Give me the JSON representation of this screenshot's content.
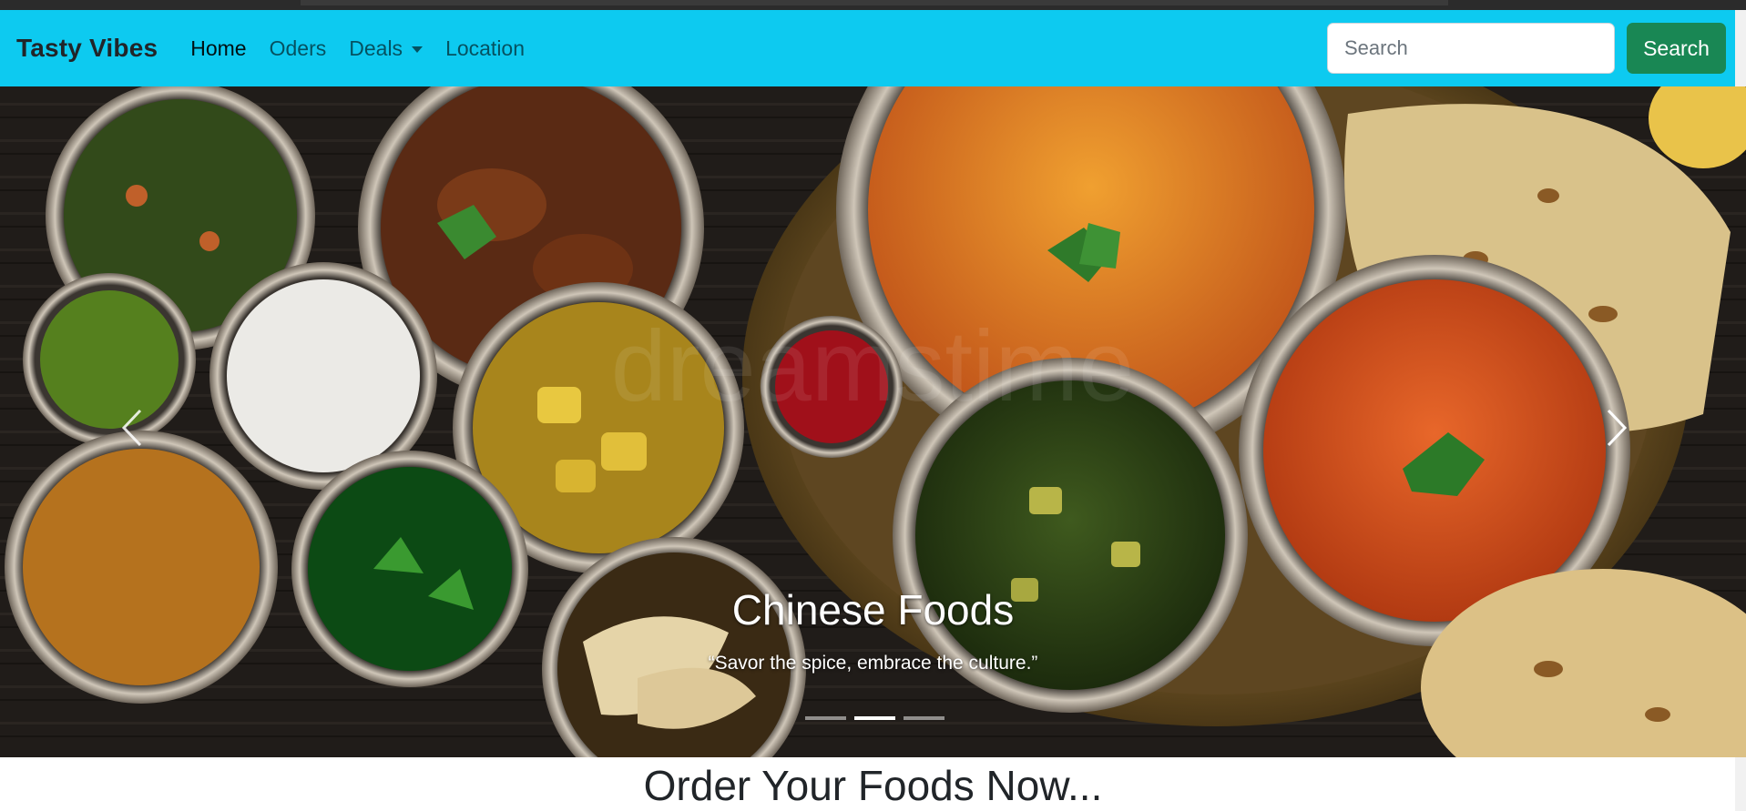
{
  "theme": {
    "navbar_bg": "#0dcaf0",
    "search_btn_bg": "#198754"
  },
  "navbar": {
    "brand": "Tasty Vibes",
    "links": [
      {
        "label": "Home",
        "active": true
      },
      {
        "label": "Oders",
        "active": false
      },
      {
        "label": "Deals",
        "active": false,
        "dropdown": true
      },
      {
        "label": "Location",
        "active": false
      }
    ],
    "search": {
      "placeholder": "Search",
      "value": "",
      "button_label": "Search"
    }
  },
  "carousel": {
    "slide_title": "Chinese Foods",
    "slide_text": "“Savor the spice, embrace the culture.”",
    "watermark": "dreamstime",
    "controls": {
      "prev_icon": "chevron-left-icon",
      "next_icon": "chevron-right-icon"
    },
    "indicators": {
      "count": 3,
      "active_index": 1
    }
  },
  "main": {
    "heading": "Order Your Foods Now..."
  }
}
